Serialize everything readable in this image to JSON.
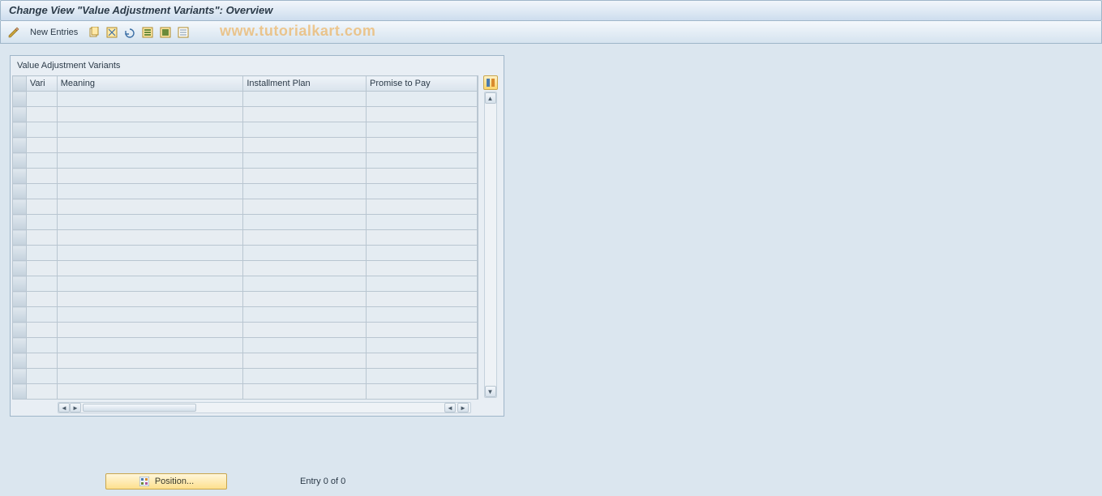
{
  "header": {
    "title": "Change View \"Value Adjustment Variants\": Overview"
  },
  "toolbar": {
    "new_entries_label": "New Entries",
    "icons": {
      "pencil": "edit-icon",
      "copy": "copy-icon",
      "exit": "exit-icon",
      "undo": "undo-icon",
      "select_all": "select-all-icon",
      "deselect_all": "deselect-all-icon",
      "list": "list-icon"
    }
  },
  "watermark": "www.tutorialkart.com",
  "grid": {
    "group_title": "Value Adjustment Variants",
    "columns": {
      "vari": "Vari",
      "meaning": "Meaning",
      "installment": "Installment Plan",
      "promise": "Promise to Pay"
    },
    "rows": 20
  },
  "footer": {
    "position_label": "Position...",
    "entry_text": "Entry 0 of 0"
  }
}
